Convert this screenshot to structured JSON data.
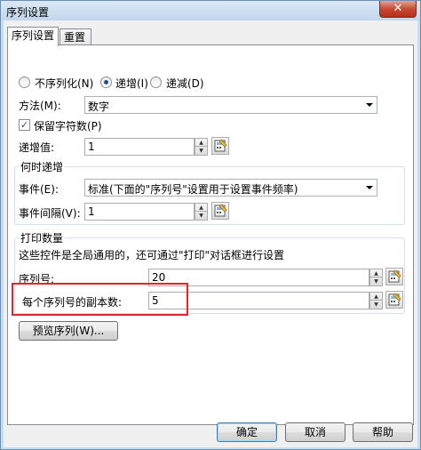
{
  "window": {
    "title": "序列设置",
    "close_glyph": "✕"
  },
  "tabs": [
    {
      "label": "序列设置"
    },
    {
      "label": "重置"
    }
  ],
  "mode": {
    "options": [
      {
        "label": "不序列化(N)",
        "checked": false
      },
      {
        "label": "递增(I)",
        "checked": true
      },
      {
        "label": "递减(D)",
        "checked": false
      }
    ]
  },
  "method": {
    "label": "方法(M):",
    "value": "数字"
  },
  "preserve_chars": {
    "label": "保留字符数(P)",
    "checked": true,
    "check_glyph": "✓"
  },
  "increment": {
    "label": "递增值:",
    "value": "1"
  },
  "when_increment": {
    "group_title": "何时递增",
    "event_label": "事件(E):",
    "event_value": "标准(下面的\"序列号\"设置用于设置事件频率)",
    "interval_label": "事件间隔(V):",
    "interval_value": "1"
  },
  "print_count": {
    "group_title": "打印数量",
    "note": "这些控件是全局通用的，还可通过\"打印\"对话框进行设置",
    "serial_label": "序列号:",
    "serial_value": "20",
    "copies_label": "每个序列号的副本数:",
    "copies_value": "5"
  },
  "preview_button": "预览序列(W)...",
  "footer": {
    "ok": "确定",
    "cancel": "取消",
    "help": "帮助"
  },
  "spin_glyphs": {
    "up": "▲",
    "down": "▼"
  },
  "colors": {
    "highlight": "#e0262c",
    "title_bar": "#c9ddf1",
    "close_button": "#c84a33"
  }
}
